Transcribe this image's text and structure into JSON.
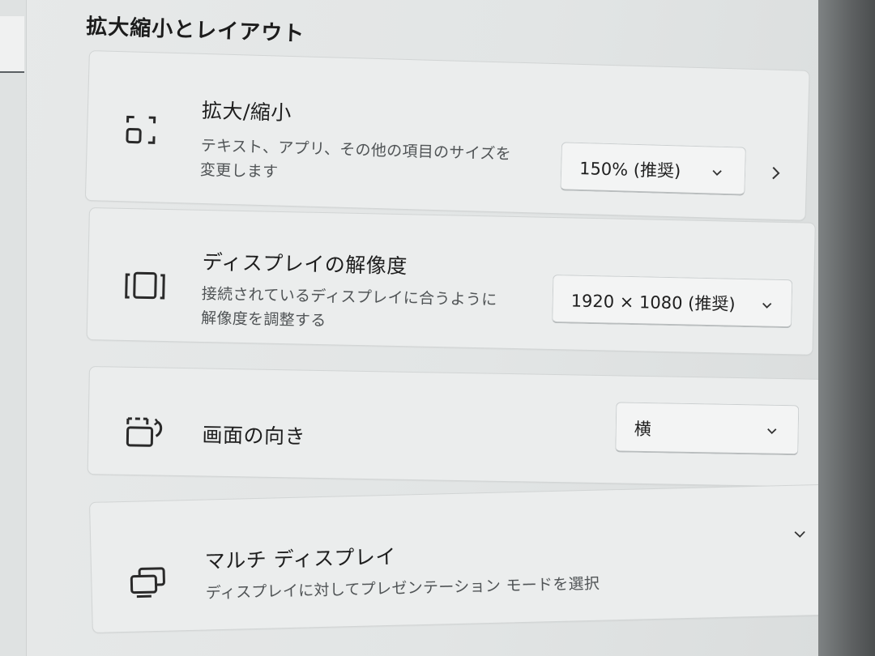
{
  "section": {
    "title": "拡大縮小とレイアウト"
  },
  "scale": {
    "title": "拡大/縮小",
    "description_line1": "テキスト、アプリ、その他の項目のサイズを",
    "description_line2": "変更します",
    "value": "150% (推奨)",
    "icon": "scale-icon"
  },
  "resolution": {
    "title": "ディスプレイの解像度",
    "description_line1": "接続されているディスプレイに合うように",
    "description_line2": "解像度を調整する",
    "value": "1920 × 1080 (推奨)",
    "icon": "resolution-icon"
  },
  "orientation": {
    "title": "画面の向き",
    "value": "横",
    "icon": "rotate-icon"
  },
  "multi_display": {
    "title": "マルチ ディスプレイ",
    "description": "ディスプレイに対してプレゼンテーション モードを選択",
    "icon": "multi-display-icon"
  },
  "colors": {
    "card_background": "#ebeded",
    "page_background": "#e4e6e6",
    "text_primary": "#1e1e1e",
    "text_secondary": "#505456"
  }
}
